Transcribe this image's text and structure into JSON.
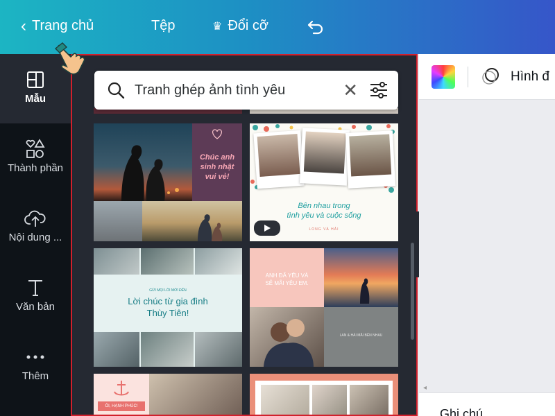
{
  "topbar": {
    "home_label": "Trang chủ",
    "file_label": "Tệp",
    "resize_label": "Đổi cỡ"
  },
  "sidebar": {
    "items": [
      {
        "label": "Mẫu",
        "icon": "template-icon",
        "active": true
      },
      {
        "label": "Thành phần",
        "icon": "elements-icon"
      },
      {
        "label": "Nội dung ...",
        "icon": "upload-cloud-icon"
      },
      {
        "label": "Văn bản",
        "icon": "text-icon"
      },
      {
        "label": "Thêm",
        "icon": "more-dots-icon"
      }
    ]
  },
  "search": {
    "query": "Tranh ghép ảnh tình yêu"
  },
  "templates": [
    {
      "text_lines": [
        "Chúc anh",
        "sinh nhật",
        "vui vẻ!"
      ]
    },
    {
      "text_lines": [
        "Bên nhau trong",
        "tình yêu và cuộc sống"
      ],
      "small": "LONG VÀ HẢI",
      "has_video": true
    },
    {
      "header": "GỬI MỌI LỜI MỚI ĐẾN",
      "text_lines": [
        "Lời chúc từ gia đình",
        "Thùy Tiên!"
      ]
    },
    {
      "text_lines": [
        "ANH ĐÃ YÊU VÀ",
        "SẼ MÃI YÊU EM."
      ],
      "small": "LAN & HẢI MÃI BÊN NHAU"
    },
    {
      "banner": "ÔI, HẠNH PHÚC!"
    },
    {}
  ],
  "toolbar": {
    "shape_label": "Hình đ"
  },
  "notes": {
    "label": "Ghi chú"
  },
  "colors": {
    "accent_border": "#d2202c",
    "panel_bg": "#252932",
    "rail_bg": "#0e1318"
  }
}
